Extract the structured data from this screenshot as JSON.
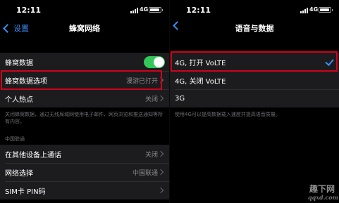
{
  "left": {
    "status": {
      "time": "12:11",
      "network": "4G"
    },
    "nav": {
      "back_label": "设置",
      "title": "蜂窝网络"
    },
    "group1": [
      {
        "label": "蜂窝数据",
        "toggle": true
      },
      {
        "label": "蜂窝数据选项",
        "value": "漫游已打开"
      },
      {
        "label": "个人热点",
        "value": "关闭"
      }
    ],
    "footnote": "关闭蜂窝数据，通过无线局域网使用电子邮件、网页浏览和推送通知等所有内容。",
    "section_header": "中国联通",
    "group2": [
      {
        "label": "在其他设备上通话",
        "value": "关闭"
      },
      {
        "label": "网络选择",
        "value": "中国联通"
      },
      {
        "label": "SIM卡 PIN码",
        "value": ""
      }
    ]
  },
  "right": {
    "status": {
      "time": "12:11",
      "network": "4G"
    },
    "nav": {
      "title": "语音与数据"
    },
    "options": [
      {
        "label": "4G, 打开 VoLTE",
        "selected": true
      },
      {
        "label": "4G, 关闭 VoLTE",
        "selected": false
      },
      {
        "label": "3G",
        "selected": false
      }
    ],
    "footnote": "使用4G可以提高数据载入速度并提高语音质量。"
  },
  "colors": {
    "accent": "#3a8ef6",
    "toggle_on": "#34c759",
    "highlight": "#d0021b",
    "cell_bg": "#1c1c1e",
    "background": "#000000"
  },
  "watermark": {
    "line1": "趣下网",
    "line2": "qqxd.com"
  }
}
